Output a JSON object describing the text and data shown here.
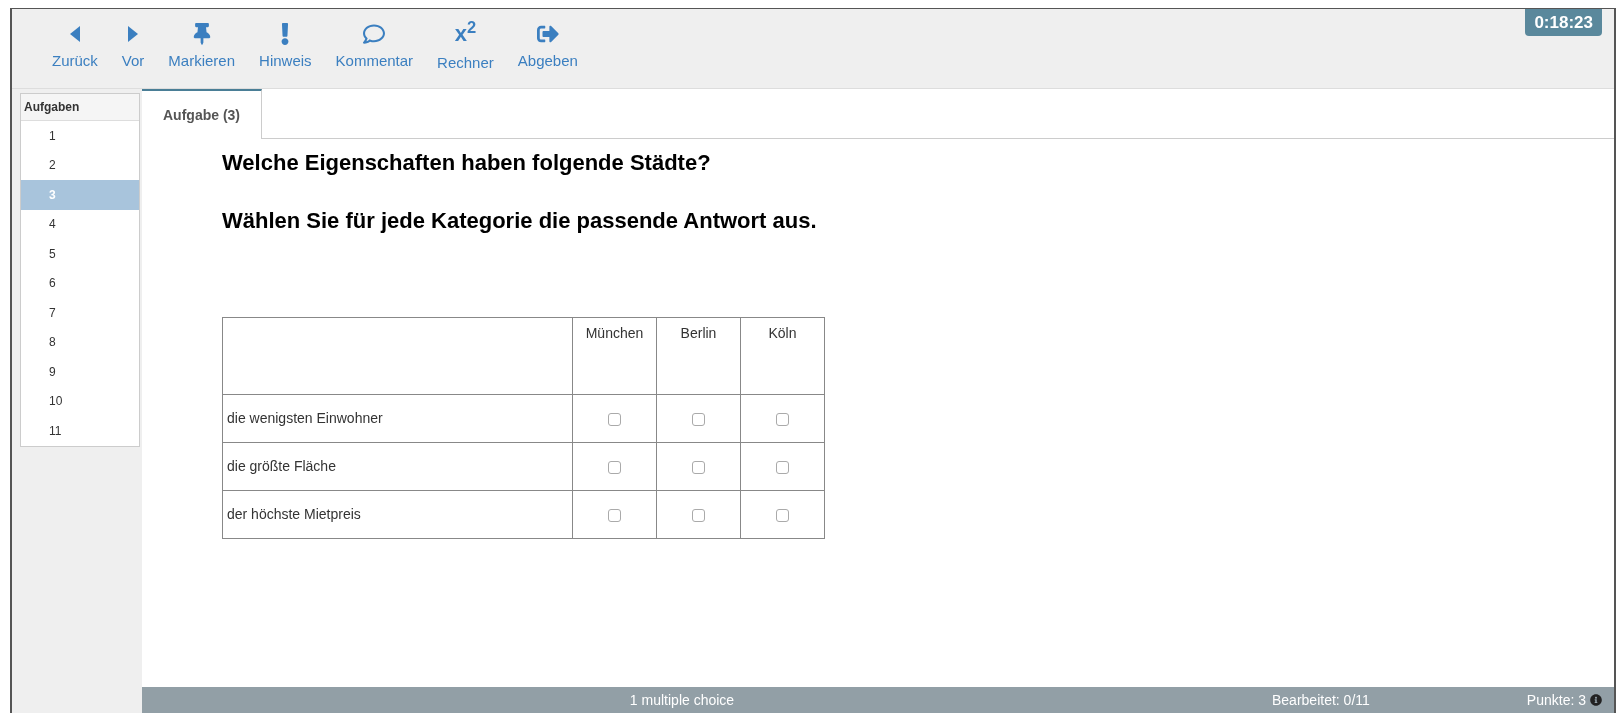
{
  "toolbar": [
    {
      "kind": "back",
      "label": "Zurück"
    },
    {
      "kind": "forward",
      "label": "Vor"
    },
    {
      "kind": "pin",
      "label": "Markieren"
    },
    {
      "kind": "hint",
      "label": "Hinweis"
    },
    {
      "kind": "comment",
      "label": "Kommentar"
    },
    {
      "kind": "glyph",
      "glyph": "x$^{2}$",
      "label": "Rechner"
    },
    {
      "kind": "submit",
      "label": "Abgeben"
    }
  ],
  "timer": "0:18:23",
  "sidebar": {
    "title": "Aufgaben",
    "items": [
      {
        "label": "1",
        "selected": false
      },
      {
        "label": "2",
        "selected": false
      },
      {
        "label": "3",
        "selected": true
      },
      {
        "label": "4",
        "selected": false
      },
      {
        "label": "5",
        "selected": false
      },
      {
        "label": "6",
        "selected": false
      },
      {
        "label": "7",
        "selected": false
      },
      {
        "label": "8",
        "selected": false
      },
      {
        "label": "9",
        "selected": false
      },
      {
        "label": "10",
        "selected": false
      },
      {
        "label": "11",
        "selected": false
      }
    ]
  },
  "tab": {
    "label": "Aufgabe (3)",
    "selected": true
  },
  "question": [
    "Welche Eigenschaften haben folgende Städte?",
    "Wählen Sie für jede Kategorie die passende Antwort aus."
  ],
  "table": {
    "columns": [
      "München",
      "Berlin",
      "Köln"
    ],
    "rows": [
      {
        "label": "die wenigsten Einwohner",
        "checked": [
          false,
          false,
          false
        ]
      },
      {
        "label": "die größte Fläche",
        "checked": [
          false,
          false,
          false
        ]
      },
      {
        "label": "der höchste Mietpreis",
        "checked": [
          false,
          false,
          false
        ]
      }
    ]
  },
  "status_bar": {
    "type": "1 multiple choice",
    "progress": "Bearbeitet: 0/11",
    "points": "Punkte: 3"
  }
}
